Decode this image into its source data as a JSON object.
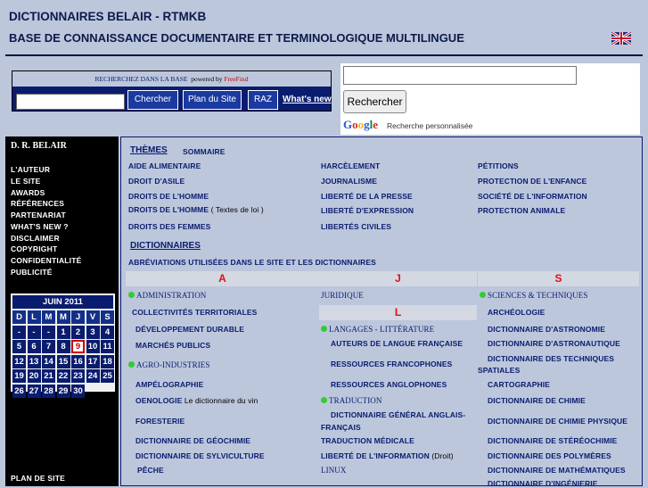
{
  "header": {
    "title": "DICTIONNAIRES BELAIR - RTMKB",
    "subtitle": "BASE DE CONNAISSANCE DOCUMENTAIRE ET TERMINOLOGIQUE MULTILINGUE",
    "flag_icon": "uk-flag-icon"
  },
  "freefind": {
    "heading": "RECHERCHEZ DANS LA BASE",
    "powered_by": "powered by",
    "brand": "FreeFind",
    "search_value": "",
    "buttons": {
      "search": "Chercher",
      "sitemap": "Plan du Site",
      "reset": "RAZ"
    },
    "whats_new": "What's new"
  },
  "google": {
    "search_value": "",
    "button": "Rechercher",
    "logo": "Google",
    "caption": "Recherche personnalisée"
  },
  "sidebar": {
    "title": "D. R. BELAIR",
    "links": [
      "L'AUTEUR",
      "LE SITE",
      "AWARDS",
      "RÉFÉRENCES",
      "PARTENARIAT",
      "WHAT'S NEW ?",
      "DISCLAIMER",
      "COPYRIGHT",
      "CONFIDENTIALITÉ",
      "PUBLICITÉ"
    ],
    "footer_link": "PLAN DE SITE"
  },
  "calendar": {
    "month": "JUIN 2011",
    "days": [
      "D",
      "L",
      "M",
      "M",
      "J",
      "V",
      "S"
    ],
    "weeks": [
      [
        "-",
        "-",
        "-",
        "1",
        "2",
        "3",
        "4"
      ],
      [
        "5",
        "6",
        "7",
        "8",
        "9",
        "10",
        "11"
      ],
      [
        "12",
        "13",
        "14",
        "15",
        "16",
        "17",
        "18"
      ],
      [
        "19",
        "20",
        "21",
        "22",
        "23",
        "24",
        "25"
      ],
      [
        "26",
        "27",
        "28",
        "29",
        "30",
        "",
        ""
      ]
    ],
    "today": "9"
  },
  "themes": {
    "heading": "THÈMES",
    "summary": "SOMMAIRE",
    "col1": [
      "AIDE ALIMENTAIRE",
      "DROIT D'ASILE",
      "DROITS DE L'HOMME",
      "DROITS DE L'HOMME",
      "DROITS DES FEMMES"
    ],
    "col1_note": "( Textes de loi )",
    "col2": [
      "HARCÈLEMENT",
      "JOURNALISME",
      "LIBERTÉ DE LA PRESSE",
      "LIBERTÉ D'EXPRESSION",
      "LIBERTÉS CIVILES"
    ],
    "col3": [
      "PÉTITIONS",
      "PROTECTION DE L'ENFANCE",
      "SOCIÉTÉ DE L'INFORMATION",
      "PROTECTION ANIMALE"
    ]
  },
  "dictionaries": {
    "heading": "DICTIONNAIRES",
    "abbr": "ABRÉVIATIONS UTILISÉES DANS LE SITE ET LES DICTIONNAIRES",
    "letters": [
      "A",
      "J",
      "S",
      "L"
    ],
    "colA": {
      "administration": "ADMINISTRATION",
      "items1": [
        "COLLECTIVITÉS TERRITORIALES",
        "DÉVELOPPEMENT DURABLE",
        "MARCHÉS PUBLICS"
      ],
      "agro": "AGRO-INDUSTRIES",
      "items2": [
        "AMPÉLOGRAPHIE",
        "OENOLOGIE",
        "FORESTERIE",
        "DICTIONNAIRE DE GÉOCHIMIE",
        "DICTIONNAIRE DE SYLVICULTURE",
        "PÊCHE"
      ],
      "oenologie_note": "Le dictionnaire du vin"
    },
    "colJ": {
      "juridique": "JURIDIQUE",
      "langages": "LANGAGES - LITTÉRATURE",
      "items1": [
        "AUTEURS DE LANGUE FRANÇAISE",
        "RESSOURCES FRANCOPHONES",
        "RESSOURCES ANGLOPHONES"
      ],
      "traduction": "TRADUCTION",
      "dict_line1": "DICTIONNAIRE GÉNÉRAL ANGLAIS-",
      "dict_line2": "FRANÇAIS",
      "medicale": "TRADUCTION MÉDICALE",
      "liberte": "LIBERTÉ DE L'INFORMATION",
      "liberte_note": "(Droit)",
      "linux": "LINUX"
    },
    "colS": {
      "sciences": "SCIENCES & TECHNIQUES",
      "items": [
        "ARCHÉOLOGIE",
        "DICTIONNAIRE D'ASTRONOMIE",
        "DICTIONNAIRE D'ASTRONAUTIQUE",
        "DICTIONNAIRE DES TECHNIQUES",
        "SPATIALES",
        "CARTOGRAPHIE",
        "DICTIONNAIRE DE CHIMIE",
        "DICTIONNAIRE DE CHIMIE PHYSIQUE",
        "DICTIONNAIRE DE STÉRÉOCHIMIE",
        "DICTIONNAIRE DES POLYMÈRES",
        "DICTIONNAIRE DE MATHÉMATIQUES",
        "DICTIONNAIRE D'INGÉNIERIE"
      ]
    }
  }
}
